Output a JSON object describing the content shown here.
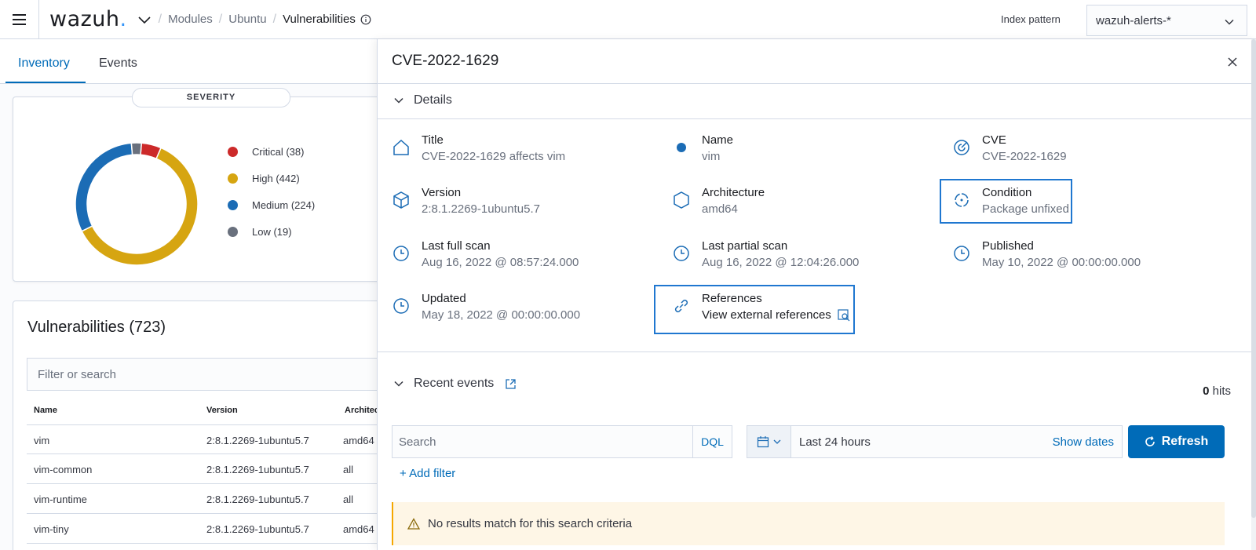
{
  "header": {
    "logo_text": "wazuh",
    "logo_dot": ".",
    "breadcrumb": [
      "Modules",
      "Ubuntu",
      "Vulnerabilities"
    ],
    "index_pattern_label": "Index pattern",
    "index_pattern_value": "wazuh-alerts-*"
  },
  "tabs": [
    {
      "label": "Inventory",
      "active": true
    },
    {
      "label": "Events",
      "active": false
    }
  ],
  "severity": {
    "title": "SEVERITY",
    "legend": [
      {
        "label": "Critical (38)",
        "value": 38,
        "color": "#cc2a2a"
      },
      {
        "label": "High (442)",
        "value": 442,
        "color": "#d6a511"
      },
      {
        "label": "Medium (224)",
        "value": 224,
        "color": "#1b6cb5"
      },
      {
        "label": "Low (19)",
        "value": 19,
        "color": "#69707d"
      }
    ]
  },
  "vulnerabilities": {
    "title": "Vulnerabilities (723)",
    "filter_placeholder": "Filter or search",
    "columns": [
      "Name",
      "Version",
      "Architec"
    ],
    "rows": [
      [
        "vim",
        "2:8.1.2269-1ubuntu5.7",
        "amd64"
      ],
      [
        "vim-common",
        "2:8.1.2269-1ubuntu5.7",
        "all"
      ],
      [
        "vim-runtime",
        "2:8.1.2269-1ubuntu5.7",
        "all"
      ],
      [
        "vim-tiny",
        "2:8.1.2269-1ubuntu5.7",
        "amd64"
      ]
    ]
  },
  "flyout": {
    "title": "CVE-2022-1629",
    "details_label": "Details",
    "details": [
      {
        "label": "Title",
        "value": "CVE-2022-1629 affects vim",
        "icon": "home-icon"
      },
      {
        "label": "Name",
        "value": "vim",
        "icon": "dot-icon"
      },
      {
        "label": "CVE",
        "value": "CVE-2022-1629",
        "icon": "radar-icon"
      },
      {
        "label": "Version",
        "value": "2:8.1.2269-1ubuntu5.7",
        "icon": "package-icon"
      },
      {
        "label": "Architecture",
        "value": "amd64",
        "icon": "hexagon-icon"
      },
      {
        "label": "Condition",
        "value": "Package unfixed",
        "icon": "target-icon"
      },
      {
        "label": "Last full scan",
        "value": "Aug 16, 2022 @ 08:57:24.000",
        "icon": "clock-icon"
      },
      {
        "label": "Last partial scan",
        "value": "Aug 16, 2022 @ 12:04:26.000",
        "icon": "clock-icon"
      },
      {
        "label": "Published",
        "value": "May 10, 2022 @ 00:00:00.000",
        "icon": "clock-icon"
      },
      {
        "label": "Updated",
        "value": "May 18, 2022 @ 00:00:00.000",
        "icon": "clock-icon"
      },
      {
        "label": "References",
        "value": "View external references",
        "icon": "link-icon"
      }
    ],
    "recent_events_label": "Recent events",
    "hits_count": "0",
    "hits_label": "hits",
    "search_placeholder": "Search",
    "dql_label": "DQL",
    "date_range": "Last 24 hours",
    "show_dates": "Show dates",
    "refresh_label": "Refresh",
    "add_filter": "+ Add filter",
    "no_results": "No results match for this search criteria"
  },
  "colors": {
    "primary": "#006bb8",
    "highlight_border": "#1f77d0",
    "warning_bg": "#fef6e6",
    "warning_border": "#f5a700"
  }
}
